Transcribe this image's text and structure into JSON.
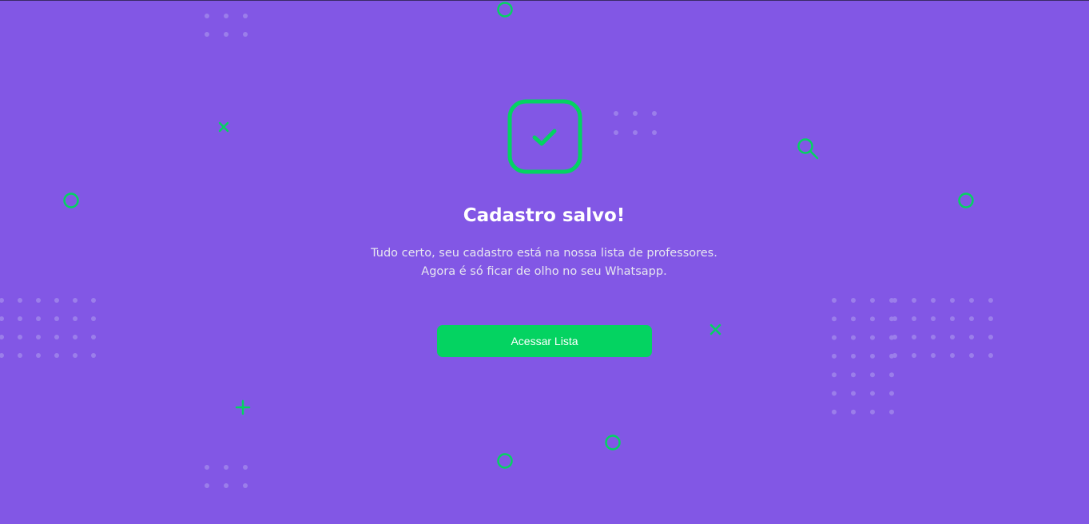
{
  "page": {
    "title": "Cadastro salvo!",
    "description_lines": [
      "Tudo certo, seu cadastro está na nossa lista de professores.",
      "Agora é só ficar de olho no seu Whatsapp."
    ],
    "button_label": "Acessar Lista"
  },
  "icons": {
    "success": "check-square-icon",
    "decorations": [
      "circle-outline-icon",
      "x-mark-icon",
      "plus-icon",
      "search-icon",
      "dot-grid"
    ]
  },
  "colors": {
    "background": "#8257E5",
    "accent_green": "#04D361",
    "title_text": "#FFFFFF",
    "body_text": "#E6E6F0",
    "dot_color": "#9B7EEA"
  }
}
